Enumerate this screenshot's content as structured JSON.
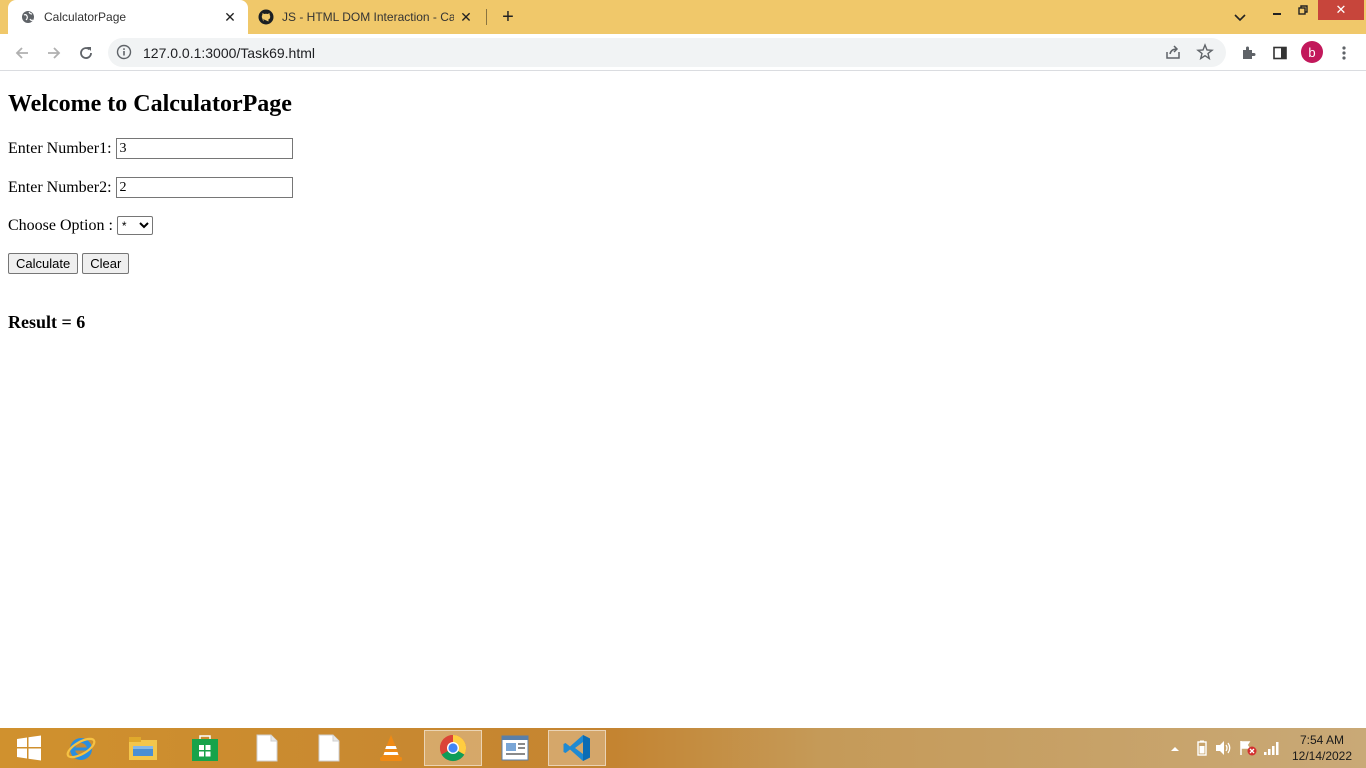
{
  "browser": {
    "tabs": [
      {
        "title": "CalculatorPage",
        "icon": "globe-icon",
        "active": true
      },
      {
        "title": "JS - HTML DOM Interaction - Cal",
        "icon": "github-icon",
        "active": false
      }
    ],
    "url": "127.0.0.1:3000/Task69.html",
    "profile_initial": "b",
    "colors": {
      "titlebar": "#f0c86a",
      "avatar": "#c2185b",
      "close_button": "#c7453b"
    }
  },
  "page": {
    "heading": "Welcome to CalculatorPage",
    "number1_label": "Enter Number1:",
    "number1_value": "3",
    "number2_label": "Enter Number2:",
    "number2_value": "2",
    "option_label": "Choose Option :",
    "option_selected": "*",
    "calculate_label": "Calculate",
    "clear_label": "Clear",
    "result": "Result = 6"
  },
  "taskbar": {
    "items": [
      "start-icon",
      "internet-explorer-icon",
      "file-explorer-icon",
      "store-icon",
      "document-icon",
      "document-icon",
      "vlc-icon",
      "chrome-icon",
      "notepad-window-icon",
      "vscode-icon"
    ],
    "active_items": [
      "chrome-icon",
      "vscode-icon"
    ],
    "time": "7:54 AM",
    "date": "12/14/2022"
  }
}
